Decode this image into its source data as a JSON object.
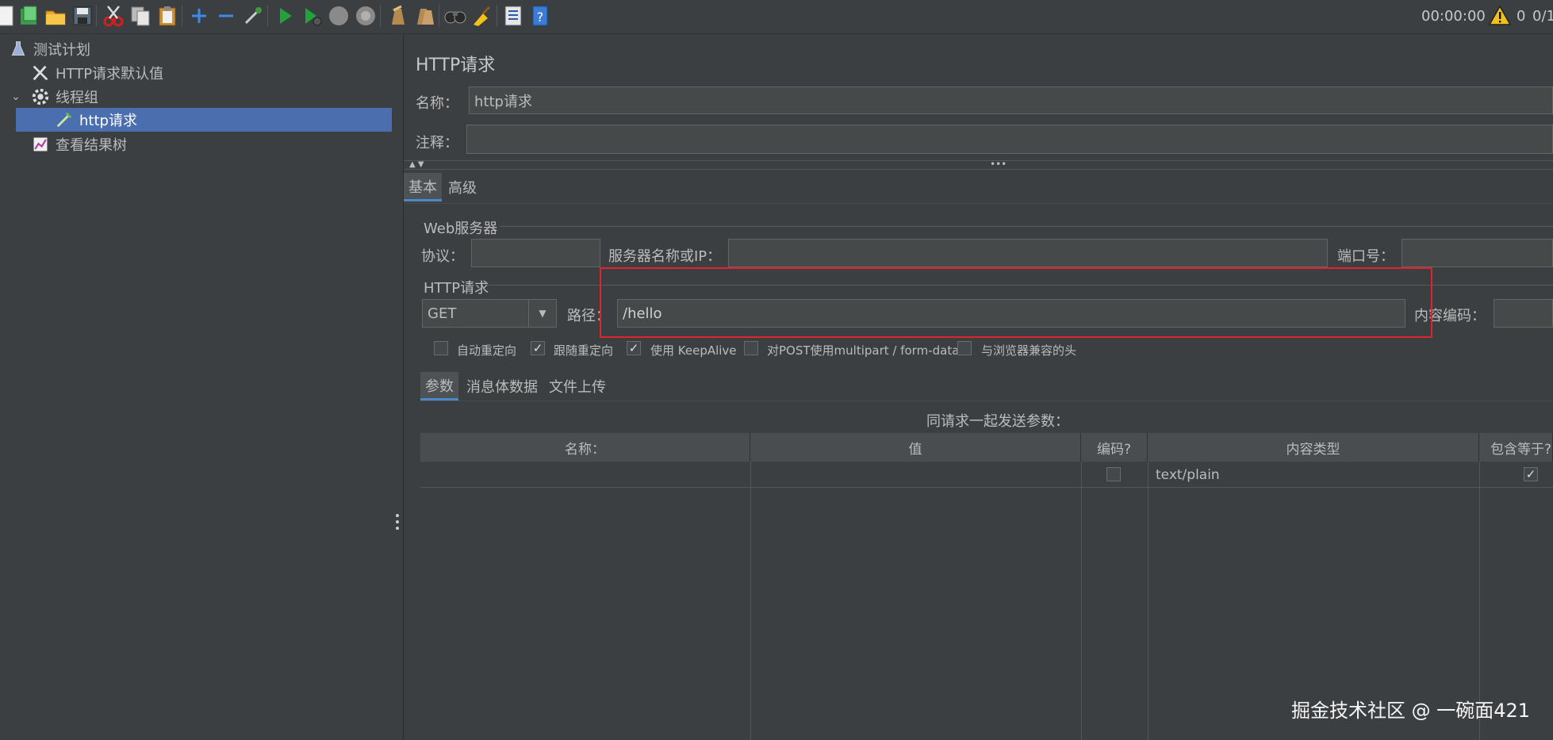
{
  "toolbar": {
    "timer": "00:00:00",
    "warning_count": "0",
    "thread_count": "0/1"
  },
  "tree": {
    "items": [
      {
        "label": "测试计划"
      },
      {
        "label": "HTTP请求默认值"
      },
      {
        "label": "线程组"
      },
      {
        "label": "http请求"
      },
      {
        "label": "查看结果树"
      }
    ]
  },
  "main": {
    "title": "HTTP请求",
    "name_label": "名称：",
    "name_value": "http请求",
    "comment_label": "注释：",
    "comment_value": "",
    "tabs": [
      {
        "label": "基本"
      },
      {
        "label": "高级"
      }
    ],
    "web_server": {
      "title": "Web服务器",
      "protocol_label": "协议：",
      "protocol_value": "",
      "server_label": "服务器名称或IP：",
      "server_value": "",
      "port_label": "端口号：",
      "port_value": ""
    },
    "http_request": {
      "title": "HTTP请求",
      "method": "GET",
      "path_label": "路径：",
      "path_value": "/hello",
      "encoding_label": "内容编码：",
      "encoding_value": ""
    },
    "checkboxes": [
      {
        "label": "自动重定向",
        "checked": false
      },
      {
        "label": "跟随重定向",
        "checked": true
      },
      {
        "label": "使用 KeepAlive",
        "checked": true
      },
      {
        "label": "对POST使用multipart / form-data",
        "checked": false
      },
      {
        "label": "与浏览器兼容的头",
        "checked": false
      }
    ],
    "sub_tabs": [
      {
        "label": "参数"
      },
      {
        "label": "消息体数据"
      },
      {
        "label": "文件上传"
      }
    ],
    "params_caption": "同请求一起发送参数：",
    "table": {
      "headers": [
        "名称：",
        "值",
        "编码?",
        "内容类型",
        "包含等于?"
      ],
      "rows": [
        {
          "name": "",
          "value": "",
          "encode": false,
          "content_type": "text/plain",
          "include_equals": true
        }
      ]
    }
  },
  "watermark": "掘金技术社区 @ 一碗面421",
  "colors": {
    "background": "#3c3f41",
    "selection": "#4b6eaf",
    "highlight_box": "#e0242c"
  }
}
